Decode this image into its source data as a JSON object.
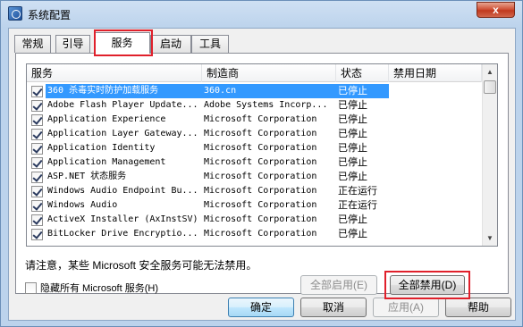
{
  "window": {
    "title": "系统配置",
    "close_glyph": "x"
  },
  "tabs": [
    {
      "label": "常规"
    },
    {
      "label": "引导"
    },
    {
      "label": "服务"
    },
    {
      "label": "启动"
    },
    {
      "label": "工具"
    }
  ],
  "list": {
    "headers": {
      "service": "服务",
      "vendor": "制造商",
      "status": "状态",
      "disabled_date": "禁用日期"
    },
    "rows": [
      {
        "name": "360 杀毒实时防护加载服务",
        "vendor": "360.cn",
        "status": "已停止",
        "checked": true,
        "selected": true
      },
      {
        "name": "Adobe Flash Player Update...",
        "vendor": "Adobe Systems Incorp...",
        "status": "已停止",
        "checked": true
      },
      {
        "name": "Application Experience",
        "vendor": "Microsoft Corporation",
        "status": "已停止",
        "checked": true
      },
      {
        "name": "Application Layer Gateway...",
        "vendor": "Microsoft Corporation",
        "status": "已停止",
        "checked": true
      },
      {
        "name": "Application Identity",
        "vendor": "Microsoft Corporation",
        "status": "已停止",
        "checked": true
      },
      {
        "name": "Application Management",
        "vendor": "Microsoft Corporation",
        "status": "已停止",
        "checked": true
      },
      {
        "name": "ASP.NET 状态服务",
        "vendor": "Microsoft Corporation",
        "status": "已停止",
        "checked": true
      },
      {
        "name": "Windows Audio Endpoint Bu...",
        "vendor": "Microsoft Corporation",
        "status": "正在运行",
        "checked": true
      },
      {
        "name": "Windows Audio",
        "vendor": "Microsoft Corporation",
        "status": "正在运行",
        "checked": true
      },
      {
        "name": "ActiveX Installer (AxInstSV)",
        "vendor": "Microsoft Corporation",
        "status": "已停止",
        "checked": true
      },
      {
        "name": "BitLocker Drive Encryptio...",
        "vendor": "Microsoft Corporation",
        "status": "已停止",
        "checked": true
      }
    ]
  },
  "note": "请注意，某些 Microsoft 安全服务可能无法禁用。",
  "buttons": {
    "enable_all": "全部启用(E)",
    "disable_all": "全部禁用(D)",
    "ok": "确定",
    "cancel": "取消",
    "apply": "应用(A)",
    "help": "帮助"
  },
  "hide_ms_label": "隐藏所有 Microsoft 服务(H)",
  "colors": {
    "selection": "#3399ff",
    "highlight_box": "#e0202b"
  }
}
